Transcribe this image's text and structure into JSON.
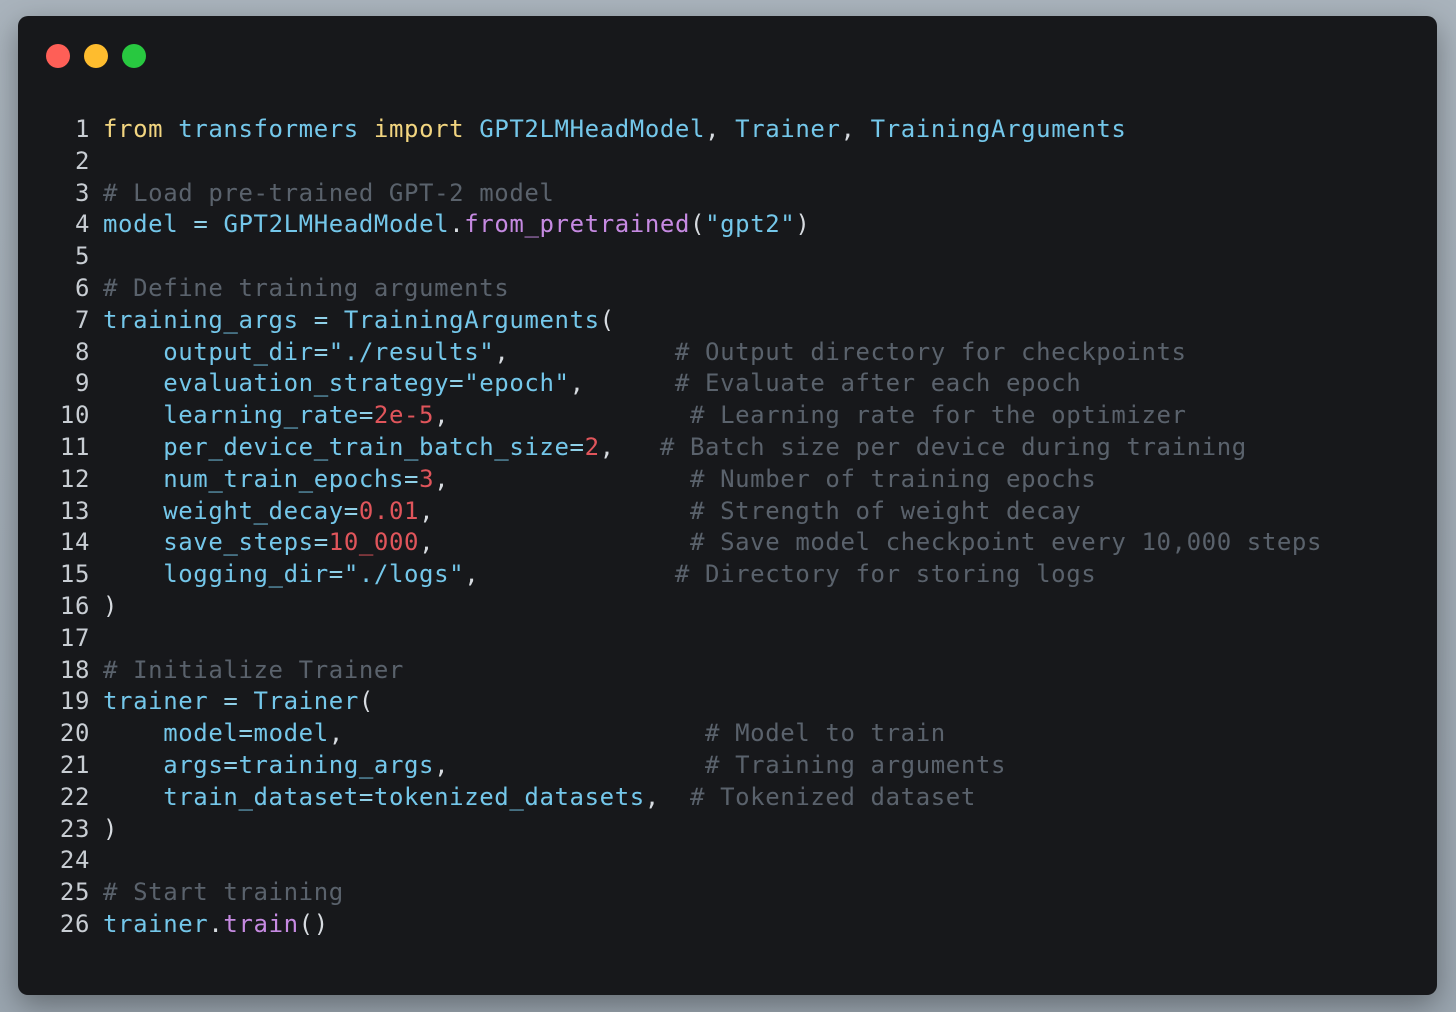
{
  "window": {
    "buttons": {
      "close_color": "#fe5f57",
      "minimize_color": "#febc2e",
      "maximize_color": "#28c840"
    }
  },
  "code": {
    "language": "python",
    "lines": [
      {
        "n": "1",
        "tokens": [
          [
            "kw",
            "from"
          ],
          [
            "sp",
            " "
          ],
          [
            "id",
            "transformers"
          ],
          [
            "sp",
            " "
          ],
          [
            "kw",
            "import"
          ],
          [
            "sp",
            " "
          ],
          [
            "cls",
            "GPT2LMHeadModel"
          ],
          [
            "punc",
            ","
          ],
          [
            "sp",
            " "
          ],
          [
            "cls",
            "Trainer"
          ],
          [
            "punc",
            ","
          ],
          [
            "sp",
            " "
          ],
          [
            "cls",
            "TrainingArguments"
          ]
        ]
      },
      {
        "n": "2",
        "tokens": []
      },
      {
        "n": "3",
        "tokens": [
          [
            "cm",
            "# Load pre-trained GPT-2 model"
          ]
        ]
      },
      {
        "n": "4",
        "tokens": [
          [
            "id",
            "model"
          ],
          [
            "sp",
            " "
          ],
          [
            "op",
            "="
          ],
          [
            "sp",
            " "
          ],
          [
            "cls",
            "GPT2LMHeadModel"
          ],
          [
            "punc",
            "."
          ],
          [
            "fn",
            "from_pretrained"
          ],
          [
            "punc",
            "("
          ],
          [
            "str",
            "\"gpt2\""
          ],
          [
            "punc",
            ")"
          ]
        ]
      },
      {
        "n": "5",
        "tokens": []
      },
      {
        "n": "6",
        "tokens": [
          [
            "cm",
            "# Define training arguments"
          ]
        ]
      },
      {
        "n": "7",
        "tokens": [
          [
            "id",
            "training_args"
          ],
          [
            "sp",
            " "
          ],
          [
            "op",
            "="
          ],
          [
            "sp",
            " "
          ],
          [
            "cls",
            "TrainingArguments"
          ],
          [
            "punc",
            "("
          ]
        ]
      },
      {
        "n": "8",
        "tokens": [
          [
            "sp",
            "    "
          ],
          [
            "id",
            "output_dir"
          ],
          [
            "op",
            "="
          ],
          [
            "str",
            "\"./results\""
          ],
          [
            "punc",
            ","
          ],
          [
            "sp",
            "           "
          ],
          [
            "cm",
            "# Output directory for checkpoints"
          ]
        ]
      },
      {
        "n": "9",
        "tokens": [
          [
            "sp",
            "    "
          ],
          [
            "id",
            "evaluation_strategy"
          ],
          [
            "op",
            "="
          ],
          [
            "str",
            "\"epoch\""
          ],
          [
            "punc",
            ","
          ],
          [
            "sp",
            "      "
          ],
          [
            "cm",
            "# Evaluate after each epoch"
          ]
        ]
      },
      {
        "n": "10",
        "tokens": [
          [
            "sp",
            "    "
          ],
          [
            "id",
            "learning_rate"
          ],
          [
            "op",
            "="
          ],
          [
            "num",
            "2e-5"
          ],
          [
            "punc",
            ","
          ],
          [
            "sp",
            "                "
          ],
          [
            "cm",
            "# Learning rate for the optimizer"
          ]
        ]
      },
      {
        "n": "11",
        "tokens": [
          [
            "sp",
            "    "
          ],
          [
            "id",
            "per_device_train_batch_size"
          ],
          [
            "op",
            "="
          ],
          [
            "num",
            "2"
          ],
          [
            "punc",
            ","
          ],
          [
            "sp",
            "   "
          ],
          [
            "cm",
            "# Batch size per device during training"
          ]
        ]
      },
      {
        "n": "12",
        "tokens": [
          [
            "sp",
            "    "
          ],
          [
            "id",
            "num_train_epochs"
          ],
          [
            "op",
            "="
          ],
          [
            "num",
            "3"
          ],
          [
            "punc",
            ","
          ],
          [
            "sp",
            "                "
          ],
          [
            "cm",
            "# Number of training epochs"
          ]
        ]
      },
      {
        "n": "13",
        "tokens": [
          [
            "sp",
            "    "
          ],
          [
            "id",
            "weight_decay"
          ],
          [
            "op",
            "="
          ],
          [
            "num",
            "0.01"
          ],
          [
            "punc",
            ","
          ],
          [
            "sp",
            "                 "
          ],
          [
            "cm",
            "# Strength of weight decay"
          ]
        ]
      },
      {
        "n": "14",
        "tokens": [
          [
            "sp",
            "    "
          ],
          [
            "id",
            "save_steps"
          ],
          [
            "op",
            "="
          ],
          [
            "num",
            "10_000"
          ],
          [
            "punc",
            ","
          ],
          [
            "sp",
            "                 "
          ],
          [
            "cm",
            "# Save model checkpoint every 10,000 steps"
          ]
        ]
      },
      {
        "n": "15",
        "tokens": [
          [
            "sp",
            "    "
          ],
          [
            "id",
            "logging_dir"
          ],
          [
            "op",
            "="
          ],
          [
            "str",
            "\"./logs\""
          ],
          [
            "punc",
            ","
          ],
          [
            "sp",
            "             "
          ],
          [
            "cm",
            "# Directory for storing logs"
          ]
        ]
      },
      {
        "n": "16",
        "tokens": [
          [
            "punc",
            ")"
          ]
        ]
      },
      {
        "n": "17",
        "tokens": []
      },
      {
        "n": "18",
        "tokens": [
          [
            "cm",
            "# Initialize Trainer"
          ]
        ]
      },
      {
        "n": "19",
        "tokens": [
          [
            "id",
            "trainer"
          ],
          [
            "sp",
            " "
          ],
          [
            "op",
            "="
          ],
          [
            "sp",
            " "
          ],
          [
            "cls",
            "Trainer"
          ],
          [
            "punc",
            "("
          ]
        ]
      },
      {
        "n": "20",
        "tokens": [
          [
            "sp",
            "    "
          ],
          [
            "id",
            "model"
          ],
          [
            "op",
            "="
          ],
          [
            "id",
            "model"
          ],
          [
            "punc",
            ","
          ],
          [
            "sp",
            "                        "
          ],
          [
            "cm",
            "# Model to train"
          ]
        ]
      },
      {
        "n": "21",
        "tokens": [
          [
            "sp",
            "    "
          ],
          [
            "id",
            "args"
          ],
          [
            "op",
            "="
          ],
          [
            "id",
            "training_args"
          ],
          [
            "punc",
            ","
          ],
          [
            "sp",
            "                 "
          ],
          [
            "cm",
            "# Training arguments"
          ]
        ]
      },
      {
        "n": "22",
        "tokens": [
          [
            "sp",
            "    "
          ],
          [
            "id",
            "train_dataset"
          ],
          [
            "op",
            "="
          ],
          [
            "id",
            "tokenized_datasets"
          ],
          [
            "punc",
            ","
          ],
          [
            "sp",
            "  "
          ],
          [
            "cm",
            "# Tokenized dataset"
          ]
        ]
      },
      {
        "n": "23",
        "tokens": [
          [
            "punc",
            ")"
          ]
        ]
      },
      {
        "n": "24",
        "tokens": []
      },
      {
        "n": "25",
        "tokens": [
          [
            "cm",
            "# Start training"
          ]
        ]
      },
      {
        "n": "26",
        "tokens": [
          [
            "id",
            "trainer"
          ],
          [
            "punc",
            "."
          ],
          [
            "fn",
            "train"
          ],
          [
            "punc",
            "()"
          ]
        ]
      }
    ]
  }
}
